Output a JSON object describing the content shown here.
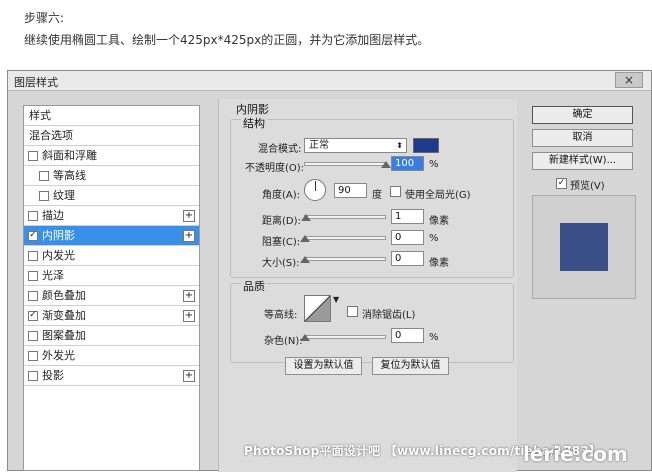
{
  "article": {
    "step_title": "步骤六:",
    "step_desc": "继续使用椭圆工具、绘制一个425px*425px的正圆，并为它添加图层样式。"
  },
  "dialog": {
    "title": "图层样式",
    "close_glyph": "×",
    "styles": [
      {
        "label": "样式",
        "checkbox": false,
        "checked": false,
        "plus": false,
        "indent": 0,
        "selected": false
      },
      {
        "label": "混合选项",
        "checkbox": false,
        "checked": false,
        "plus": false,
        "indent": 0,
        "selected": false
      },
      {
        "label": "斜面和浮雕",
        "checkbox": true,
        "checked": false,
        "plus": false,
        "indent": 0,
        "selected": false
      },
      {
        "label": "等高线",
        "checkbox": true,
        "checked": false,
        "plus": false,
        "indent": 1,
        "selected": false
      },
      {
        "label": "纹理",
        "checkbox": true,
        "checked": false,
        "plus": false,
        "indent": 1,
        "selected": false
      },
      {
        "label": "描边",
        "checkbox": true,
        "checked": false,
        "plus": true,
        "indent": 0,
        "selected": false
      },
      {
        "label": "内阴影",
        "checkbox": true,
        "checked": true,
        "plus": true,
        "indent": 0,
        "selected": true
      },
      {
        "label": "内发光",
        "checkbox": true,
        "checked": false,
        "plus": false,
        "indent": 0,
        "selected": false
      },
      {
        "label": "光泽",
        "checkbox": true,
        "checked": false,
        "plus": false,
        "indent": 0,
        "selected": false
      },
      {
        "label": "颜色叠加",
        "checkbox": true,
        "checked": false,
        "plus": true,
        "indent": 0,
        "selected": false
      },
      {
        "label": "渐变叠加",
        "checkbox": true,
        "checked": true,
        "plus": true,
        "indent": 0,
        "selected": false
      },
      {
        "label": "图案叠加",
        "checkbox": true,
        "checked": false,
        "plus": false,
        "indent": 0,
        "selected": false
      },
      {
        "label": "外发光",
        "checkbox": true,
        "checked": false,
        "plus": false,
        "indent": 0,
        "selected": false
      },
      {
        "label": "投影",
        "checkbox": true,
        "checked": false,
        "plus": true,
        "indent": 0,
        "selected": false
      }
    ],
    "panel": {
      "section_title": "内阴影",
      "structure": {
        "title": "结构",
        "blend_mode_label": "混合模式:",
        "blend_mode_value": "正常",
        "shadow_color": "#1e3a8c",
        "opacity_label": "不透明度(O):",
        "opacity_value": "100",
        "opacity_pct": 1.0,
        "opacity_unit": "%",
        "angle_label": "角度(A):",
        "angle_value": "90",
        "angle_unit": "度",
        "global_light_label": "使用全局光(G)",
        "global_light_checked": false,
        "distance_label": "距离(D):",
        "distance_value": "1",
        "distance_unit": "像素",
        "choke_label": "阻塞(C):",
        "choke_value": "0",
        "choke_unit": "%",
        "size_label": "大小(S):",
        "size_value": "0",
        "size_unit": "像素"
      },
      "quality": {
        "title": "品质",
        "contour_label": "等高线:",
        "antialias_label": "消除锯齿(L)",
        "antialias_checked": false,
        "noise_label": "杂色(N):",
        "noise_value": "0",
        "noise_unit": "%"
      },
      "set_default_label": "设置为默认值",
      "reset_default_label": "复位为默认值"
    },
    "buttons": {
      "ok": "确定",
      "cancel": "取消",
      "new_style": "新建样式(W)...",
      "preview_label": "预览(V)",
      "preview_checked": true
    },
    "preview_color": "#3a4f87"
  },
  "watermark": {
    "text": "PhotoShop平面设计吧 【www.linecg.com/tieba/1783】",
    "brand": "lerie.com"
  }
}
